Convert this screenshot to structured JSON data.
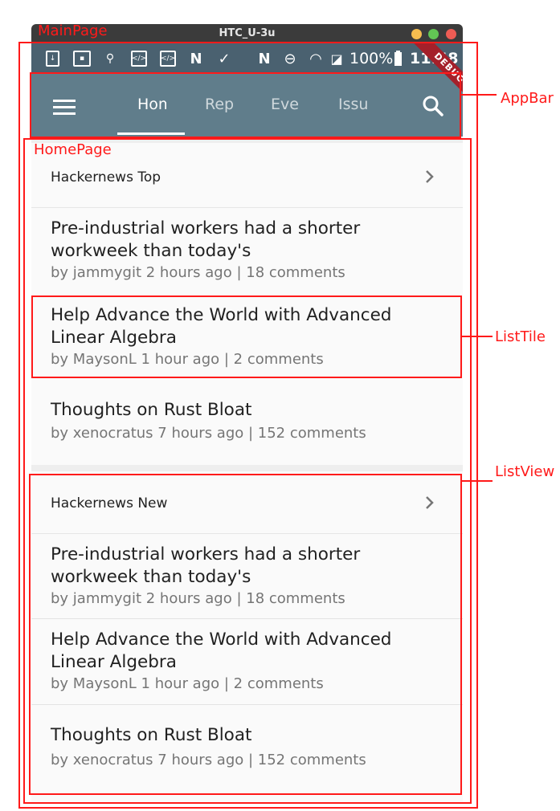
{
  "window": {
    "title": "HTC_U-3u"
  },
  "statusbar": {
    "battery": "100%",
    "time": "11:48"
  },
  "appbar": {
    "menu_icon": "hamburger-icon",
    "tabs": [
      {
        "label": "Home"
      },
      {
        "label": "Repos"
      },
      {
        "label": "Events"
      },
      {
        "label": "Issues"
      }
    ],
    "search_icon": "search-icon",
    "debug_banner": "DEBUG"
  },
  "sections": [
    {
      "header": "Hackernews Top",
      "items": [
        {
          "title": "Pre-industrial workers had a shorter workweek than today's",
          "subtitle": "by jammygit 2 hours ago | 18 comments"
        },
        {
          "title": "Help Advance the World with Advanced Linear Algebra",
          "subtitle": "by MaysonL 1 hour ago | 2 comments"
        },
        {
          "title": "Thoughts on Rust Bloat",
          "subtitle": "by xenocratus 7 hours ago | 152 comments"
        }
      ]
    },
    {
      "header": "Hackernews New",
      "items": [
        {
          "title": "Pre-industrial workers had a shorter workweek than today's",
          "subtitle": "by jammygit 2 hours ago | 18 comments"
        },
        {
          "title": "Help Advance the World with Advanced Linear Algebra",
          "subtitle": "by MaysonL 1 hour ago | 2 comments"
        },
        {
          "title": "Thoughts on Rust Bloat",
          "subtitle": "by xenocratus 7 hours ago | 152 comments"
        }
      ]
    }
  ],
  "annotations": {
    "main_page": "MainPage",
    "home_page": "HomePage",
    "app_bar": "AppBar",
    "list_tile": "ListTile",
    "list_view": "ListView"
  },
  "colors": {
    "appbar": "#607d8b",
    "statusbar": "#4a6170",
    "annotation": "#ff1a1a"
  }
}
